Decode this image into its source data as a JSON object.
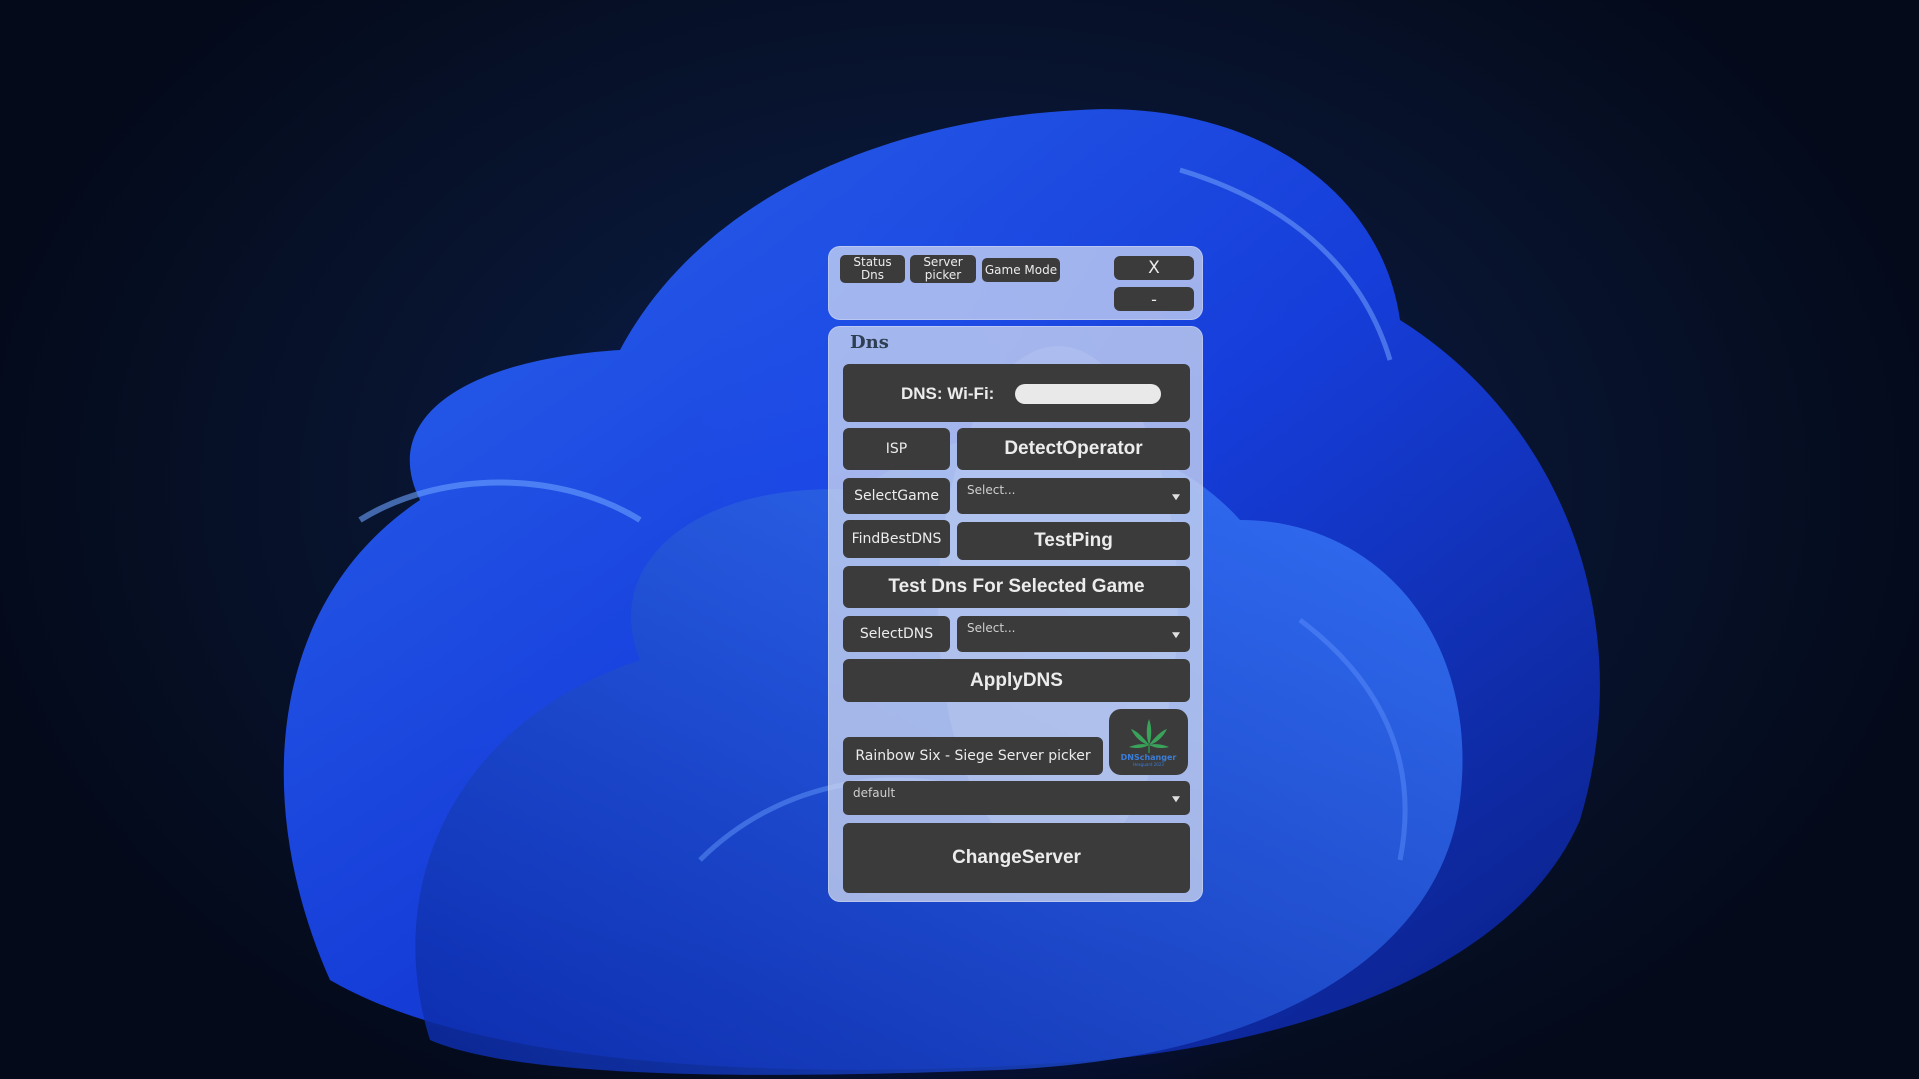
{
  "tabs": {
    "status_dns": "Status Dns",
    "server_picker": "Server picker",
    "game_mode": "Game Mode"
  },
  "window_controls": {
    "close": "X",
    "minimize": "-"
  },
  "section": {
    "title": "Dns"
  },
  "dns_status": {
    "text": "DNS: Wi-Fi:"
  },
  "buttons": {
    "isp": "ISP",
    "detect_operator": "DetectOperator",
    "select_game": "SelectGame",
    "find_best_dns": "FindBestDNS",
    "test_ping": "TestPing",
    "test_dns_selected_game": "Test Dns For Selected Game",
    "select_dns": "SelectDNS",
    "apply_dns": "ApplyDNS",
    "server_picker_label": "Rainbow Six - Siege Server picker",
    "change_server": "ChangeServer"
  },
  "dropdowns": {
    "game": "Select...",
    "dns": "Select...",
    "server": "default"
  },
  "logo": {
    "icon": "cannabis-leaf-logo-icon",
    "text": "DNSchanger",
    "subtext": "Hexguard 2023"
  },
  "colors": {
    "button_bg": "#3b3b3b",
    "panel_bg": "#d4dcf0",
    "title_text": "#2e3f54",
    "logo_accent": "#3b7dd8",
    "leaf_green": "#3aa35a"
  }
}
